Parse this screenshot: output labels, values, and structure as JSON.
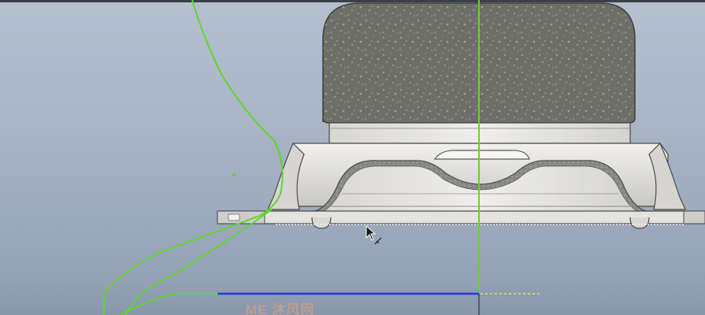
{
  "viewport": {
    "background_top": "#b5c0cf",
    "background_bottom": "#8f9cb1"
  },
  "colors": {
    "sketch_green": "#5fd62e",
    "sketch_blue": "#1f3fd8",
    "dotted_yellow": "#e8e060",
    "foam_dark": "#6f6f6a",
    "foam_speck_light": "#9a9a90",
    "foam_speck_yellow": "#a7a855",
    "part_light": "#e7e6e3",
    "part_mid": "#cfcecb",
    "part_outline": "#4b4b48",
    "section_hatch": "#7d7d78"
  },
  "cursor": {
    "icon": "arrow-pointer-icon",
    "badge_icon": "line-tool-icon"
  },
  "watermark": {
    "text": "ME 沐风网"
  }
}
